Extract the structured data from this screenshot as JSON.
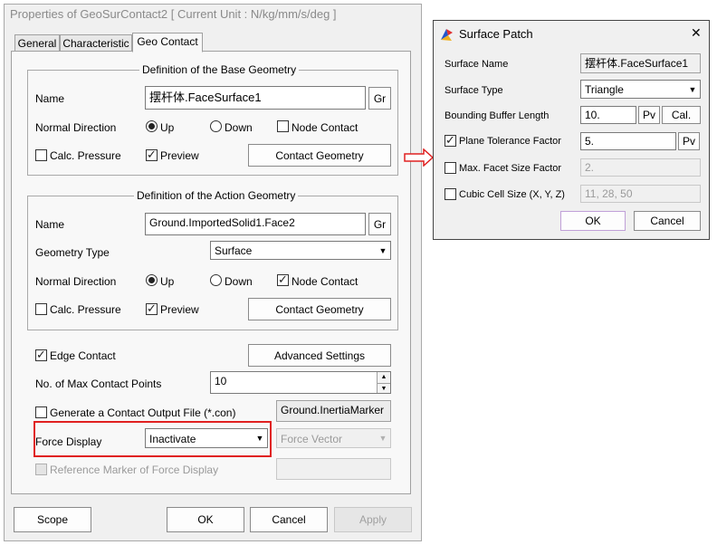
{
  "main": {
    "title": "Properties of GeoSurContact2 [ Current Unit : N/kg/mm/s/deg ]",
    "tabs": [
      "General",
      "Characteristic",
      "Geo Contact"
    ],
    "base": {
      "group_title": "Definition of the Base Geometry",
      "name_label": "Name",
      "name_value": "摆杆体.FaceSurface1",
      "gr_label": "Gr",
      "normal_label": "Normal Direction",
      "up_label": "Up",
      "down_label": "Down",
      "node_contact_label": "Node Contact",
      "calc_pressure_label": "Calc. Pressure",
      "preview_label": "Preview",
      "contact_geometry_label": "Contact Geometry"
    },
    "action": {
      "group_title": "Definition of the Action Geometry",
      "name_label": "Name",
      "name_value": "Ground.ImportedSolid1.Face2",
      "gr_label": "Gr",
      "geometry_type_label": "Geometry Type",
      "geometry_type_value": "Surface",
      "normal_label": "Normal Direction",
      "up_label": "Up",
      "down_label": "Down",
      "node_contact_label": "Node Contact",
      "calc_pressure_label": "Calc. Pressure",
      "preview_label": "Preview",
      "contact_geometry_label": "Contact Geometry"
    },
    "edge_contact_label": "Edge Contact",
    "advanced_settings_label": "Advanced Settings",
    "max_points_label": "No. of Max Contact Points",
    "max_points_value": "10",
    "output_file_label": "Generate a Contact Output File (*.con)",
    "inertia_marker_value": "Ground.InertiaMarker",
    "force_display_label": "Force Display",
    "force_display_value": "Inactivate",
    "force_vector_value": "Force Vector",
    "reference_marker_label": "Reference Marker of Force Display",
    "footer": {
      "scope": "Scope",
      "ok": "OK",
      "cancel": "Cancel",
      "apply": "Apply"
    }
  },
  "surface_patch": {
    "title": "Surface Patch",
    "close": "✕",
    "surface_name_label": "Surface Name",
    "surface_name_value": "摆杆体.FaceSurface1",
    "surface_type_label": "Surface Type",
    "surface_type_value": "Triangle",
    "bounding_label": "Bounding Buffer Length",
    "bounding_value": "10.",
    "pv_label": "Pv",
    "cal_label": "Cal.",
    "plane_tol_label": "Plane Tolerance Factor",
    "plane_tol_value": "5.",
    "max_facet_label": "Max. Facet Size Factor",
    "max_facet_value": "2.",
    "cubic_label": "Cubic Cell Size (X, Y, Z)",
    "cubic_value": "11, 28, 50",
    "ok": "OK",
    "cancel": "Cancel"
  },
  "colors": {
    "highlight": "#e02020",
    "arrow": "#e02020",
    "ok_border": "#c0a0d8"
  }
}
